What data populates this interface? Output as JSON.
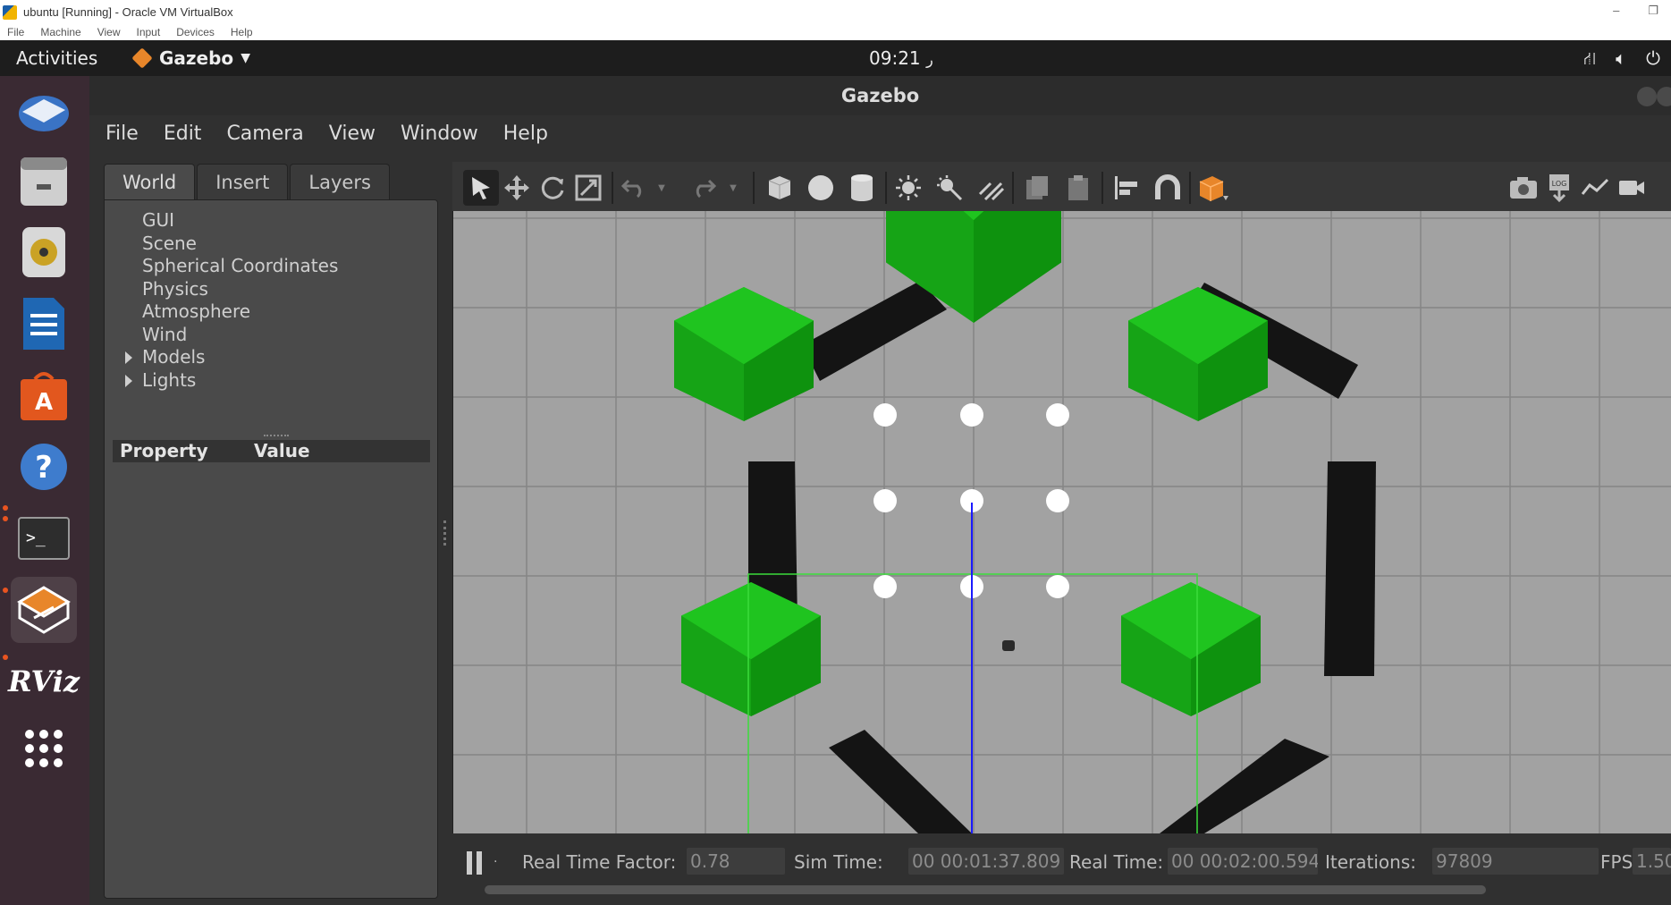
{
  "host": {
    "window_title": "ubuntu [Running] - Oracle VM VirtualBox",
    "menu": [
      "File",
      "Machine",
      "View",
      "Input",
      "Devices",
      "Help"
    ]
  },
  "ubuntu": {
    "activities": "Activities",
    "app_name": "Gazebo",
    "clock": "09:21",
    "dock": [
      {
        "name": "thunderbird-icon",
        "active": false
      },
      {
        "name": "files-icon",
        "active": false
      },
      {
        "name": "rhythmbox-icon",
        "active": false
      },
      {
        "name": "writer-icon",
        "active": false
      },
      {
        "name": "software-center-icon",
        "active": false
      },
      {
        "name": "help-icon",
        "active": false
      },
      {
        "name": "terminal-icon",
        "active": false
      },
      {
        "name": "gazebo-icon",
        "active": true
      },
      {
        "name": "rviz-icon",
        "active": false
      },
      {
        "name": "show-apps-icon",
        "active": false
      }
    ],
    "rviz_label": "RViz"
  },
  "gazebo": {
    "title": "Gazebo",
    "menu": [
      "File",
      "Edit",
      "Camera",
      "View",
      "Window",
      "Help"
    ],
    "tabs": [
      "World",
      "Insert",
      "Layers"
    ],
    "selected_tab": "World",
    "world_tree": [
      "GUI",
      "Scene",
      "Spherical Coordinates",
      "Physics",
      "Atmosphere",
      "Wind",
      "Models",
      "Lights"
    ],
    "property_header": {
      "property": "Property",
      "value": "Value"
    },
    "colors": {
      "hex_green": "#16a416",
      "arm_black": "#141414",
      "ground": "#a2a2a2",
      "selection": "#3bdc3b",
      "z_axis": "#1a1aff"
    },
    "status": {
      "real_time_factor_label": "Real Time Factor:",
      "real_time_factor": "0.78",
      "sim_time_label": "Sim Time:",
      "sim_time": "00 00:01:37.809",
      "real_time_label": "Real Time:",
      "real_time": "00 00:02:00.594",
      "iterations_label": "Iterations:",
      "iterations": "97809",
      "fps_label": "FPS:",
      "fps": "1.50"
    }
  }
}
